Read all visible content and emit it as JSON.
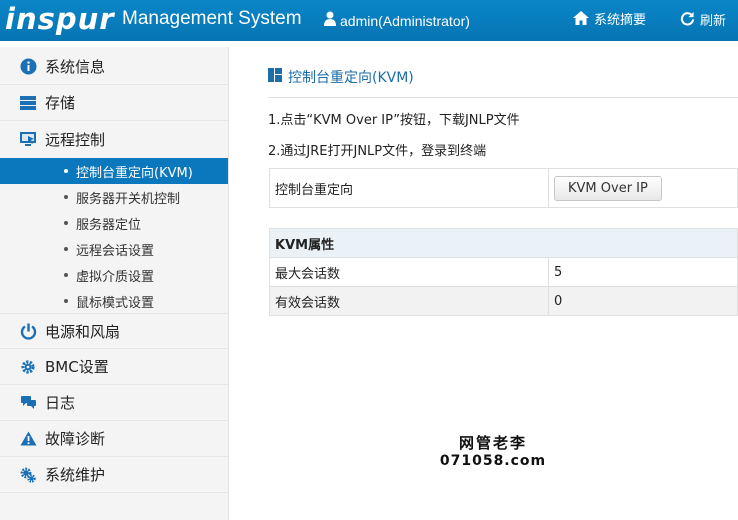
{
  "header": {
    "logo_text": "inspur",
    "app_title": "Management System",
    "user": "admin(Administrator)",
    "summary_label": "系统摘要",
    "refresh_label": "刷新"
  },
  "sidebar": {
    "items": [
      {
        "label": "系统信息",
        "icon": "info-icon"
      },
      {
        "label": "存储",
        "icon": "storage-icon"
      },
      {
        "label": "远程控制",
        "icon": "monitor-icon"
      },
      {
        "label": "电源和风扇",
        "icon": "power-icon"
      },
      {
        "label": "BMC设置",
        "icon": "gear-icon"
      },
      {
        "label": "日志",
        "icon": "chat-icon"
      },
      {
        "label": "故障诊断",
        "icon": "warning-icon"
      },
      {
        "label": "系统维护",
        "icon": "gears-icon"
      }
    ],
    "subitems": [
      {
        "label": "控制台重定向(KVM)",
        "active": true
      },
      {
        "label": "服务器开关机控制"
      },
      {
        "label": "服务器定位"
      },
      {
        "label": "远程会话设置"
      },
      {
        "label": "虚拟介质设置"
      },
      {
        "label": "鼠标模式设置"
      }
    ]
  },
  "main": {
    "title": "控制台重定向(KVM)",
    "instruction1": "1.点击“KVM Over IP”按钮，下载JNLP文件",
    "instruction2": "2.通过JRE打开JNLP文件，登录到终端",
    "redirect_label": "控制台重定向",
    "kvm_button": "KVM Over IP",
    "props_heading": "KVM属性",
    "max_sessions_label": "最大会话数",
    "max_sessions_value": "5",
    "active_sessions_label": "有效会话数",
    "active_sessions_value": "0"
  },
  "watermark": {
    "line1": "网管老李",
    "line2": "071058.com"
  },
  "colors": {
    "header_bg": "#0a86c8",
    "active_bg": "#0b78bd",
    "title_color": "#1c6ea8"
  }
}
